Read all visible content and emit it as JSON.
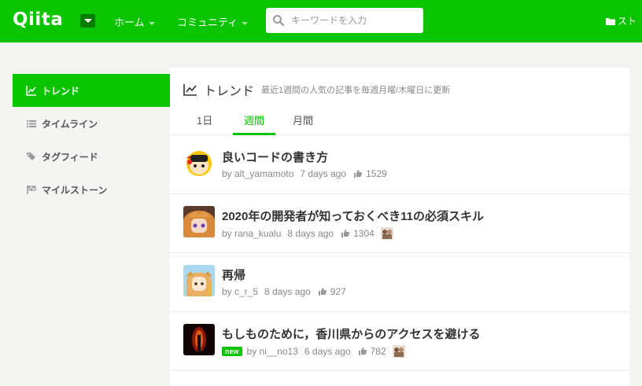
{
  "header": {
    "logo": "Qiita",
    "nav_home": "ホーム",
    "nav_community": "コミュニティ",
    "search_placeholder": "キーワードを入力",
    "stock_label": "スト"
  },
  "sidebar": {
    "items": [
      {
        "label": "トレンド",
        "icon": "trend-chart-icon"
      },
      {
        "label": "タイムライン",
        "icon": "list-icon"
      },
      {
        "label": "タグフィード",
        "icon": "tags-icon"
      },
      {
        "label": "マイルストーン",
        "icon": "flag-icon"
      }
    ]
  },
  "main": {
    "title": "トレンド",
    "subtitle": "最近1週間の人気の記事を毎週月曜/木曜日に更新",
    "tabs": [
      "1日",
      "週間",
      "月間"
    ],
    "active_tab": "週間",
    "articles": [
      {
        "title": "良いコードの書き方",
        "author": "by alt_yamamoto",
        "date": "7 days ago",
        "likes": "1529",
        "new": false,
        "org": false
      },
      {
        "title": "2020年の開発者が知っておくべき11の必須スキル",
        "author": "by rana_kualu",
        "date": "8 days ago",
        "likes": "1304",
        "new": false,
        "org": true
      },
      {
        "title": "再帰",
        "author": "by c_r_5",
        "date": "8 days ago",
        "likes": "927",
        "new": false,
        "org": false
      },
      {
        "title": "もしものために，香川県からのアクセスを避ける",
        "author": "by ni__no13",
        "date": "6 days ago",
        "likes": "782",
        "new": true,
        "new_label": "new",
        "org": true
      }
    ]
  },
  "colors": {
    "brand": "#0ac400",
    "brand_dark": "#067c00",
    "background": "#f4f4f2"
  }
}
